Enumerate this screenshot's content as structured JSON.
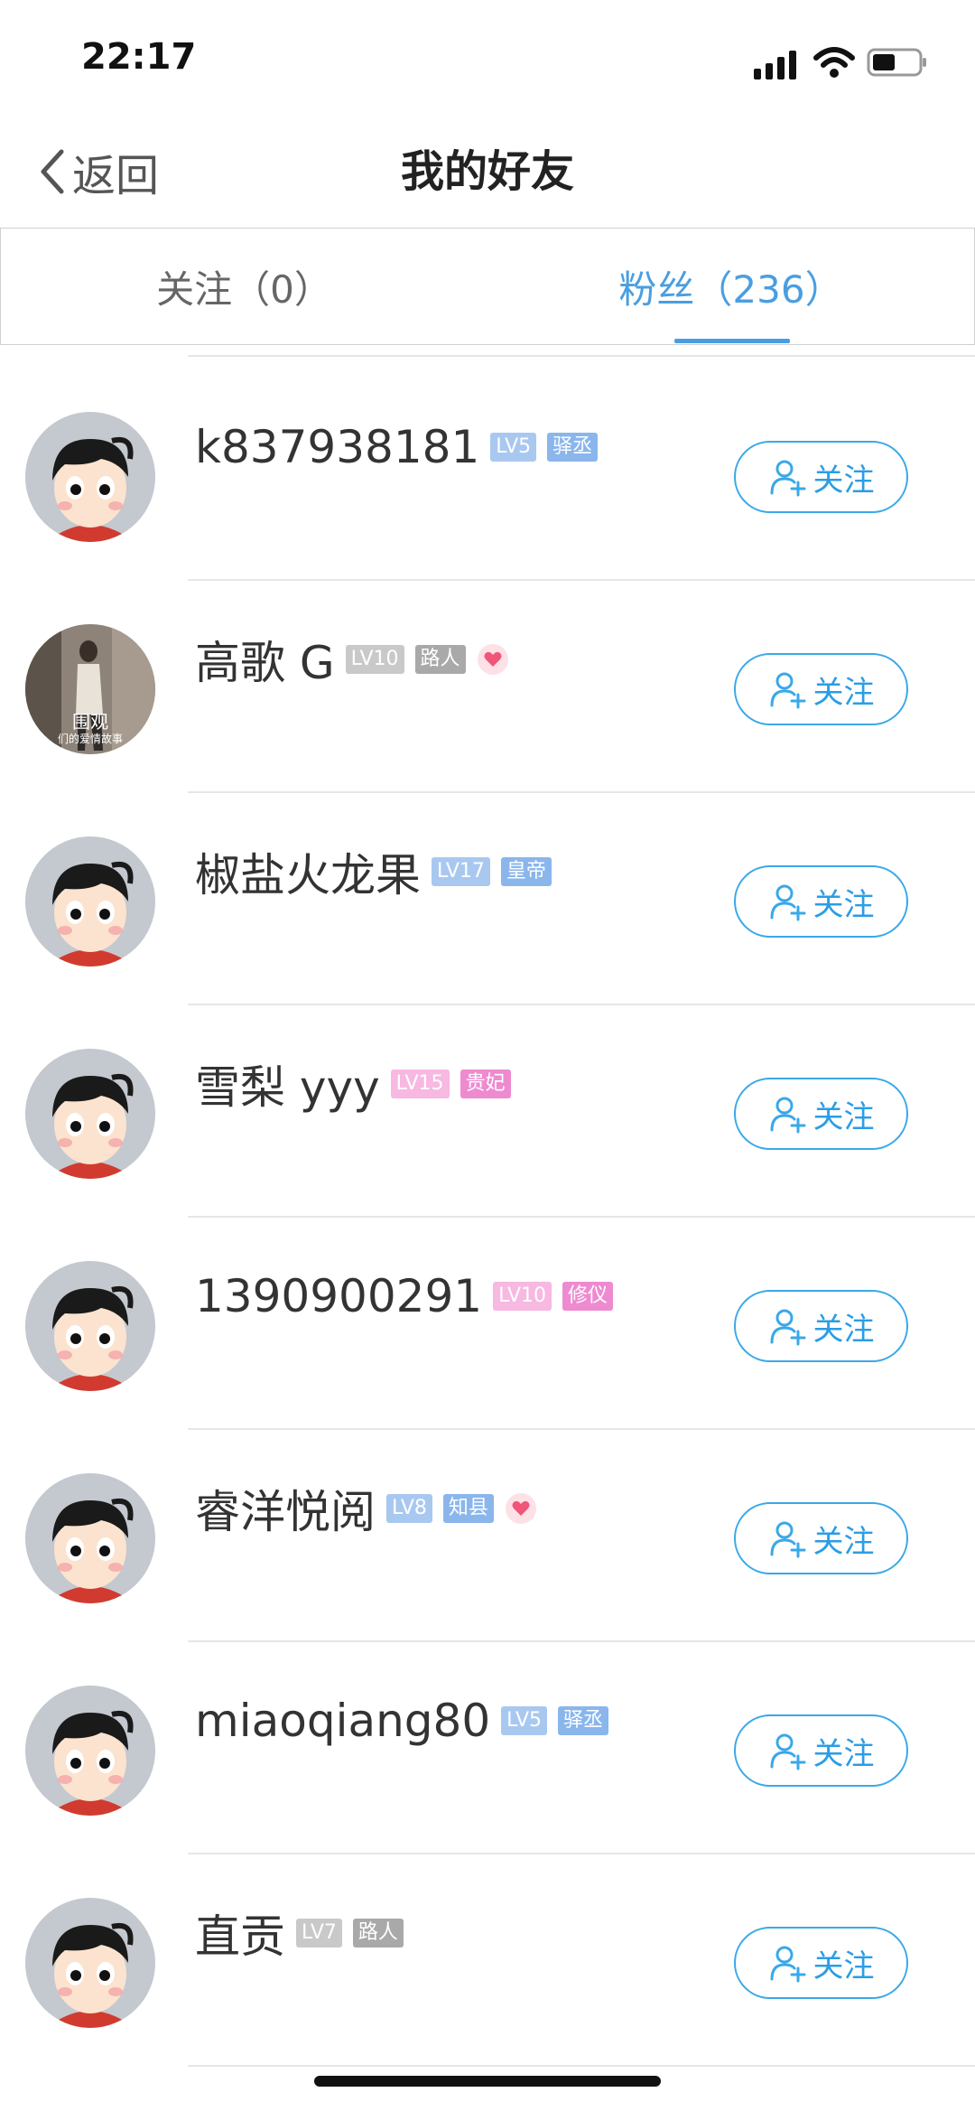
{
  "status_bar": {
    "time": "22:17"
  },
  "nav": {
    "back_label": "返回",
    "title": "我的好友"
  },
  "tabs": {
    "follow": "关注（0）",
    "fans": "粉丝（236）"
  },
  "follow_button_label": "关注",
  "colors": {
    "accent": "#4a9ee0",
    "level_blue": "#a9c8f0",
    "rank_blue": "#8ab6ec",
    "level_gray": "#c9c9c9",
    "rank_gray": "#a9a9a9",
    "level_pink": "#f7b8e1",
    "rank_pink": "#ee8ad0"
  },
  "users": [
    {
      "name": "k837938181",
      "level": "LV5",
      "rank": "驿丞",
      "tone": "blue",
      "heart": false,
      "avatar": "cartoon-boy"
    },
    {
      "name": "高歌 G",
      "level": "LV10",
      "rank": "路人",
      "tone": "gray",
      "heart": true,
      "avatar": "photo",
      "avatar_caption": "围观",
      "avatar_subcaption": "们的爱情故事"
    },
    {
      "name": "椒盐火龙果",
      "level": "LV17",
      "rank": "皇帝",
      "tone": "blue",
      "heart": false,
      "avatar": "cartoon-boy"
    },
    {
      "name": "雪梨 yyy",
      "level": "LV15",
      "rank": "贵妃",
      "tone": "pink",
      "heart": false,
      "avatar": "cartoon-boy"
    },
    {
      "name": "1390900291",
      "level": "LV10",
      "rank": "修仪",
      "tone": "pink",
      "heart": false,
      "avatar": "cartoon-boy"
    },
    {
      "name": "睿洋悦阅",
      "level": "LV8",
      "rank": "知县",
      "tone": "blue",
      "heart": true,
      "avatar": "cartoon-boy"
    },
    {
      "name": "miaoqiang80",
      "level": "LV5",
      "rank": "驿丞",
      "tone": "blue",
      "heart": false,
      "avatar": "cartoon-boy"
    },
    {
      "name": "直贡",
      "level": "LV7",
      "rank": "路人",
      "tone": "gray",
      "heart": false,
      "avatar": "cartoon-boy"
    }
  ]
}
